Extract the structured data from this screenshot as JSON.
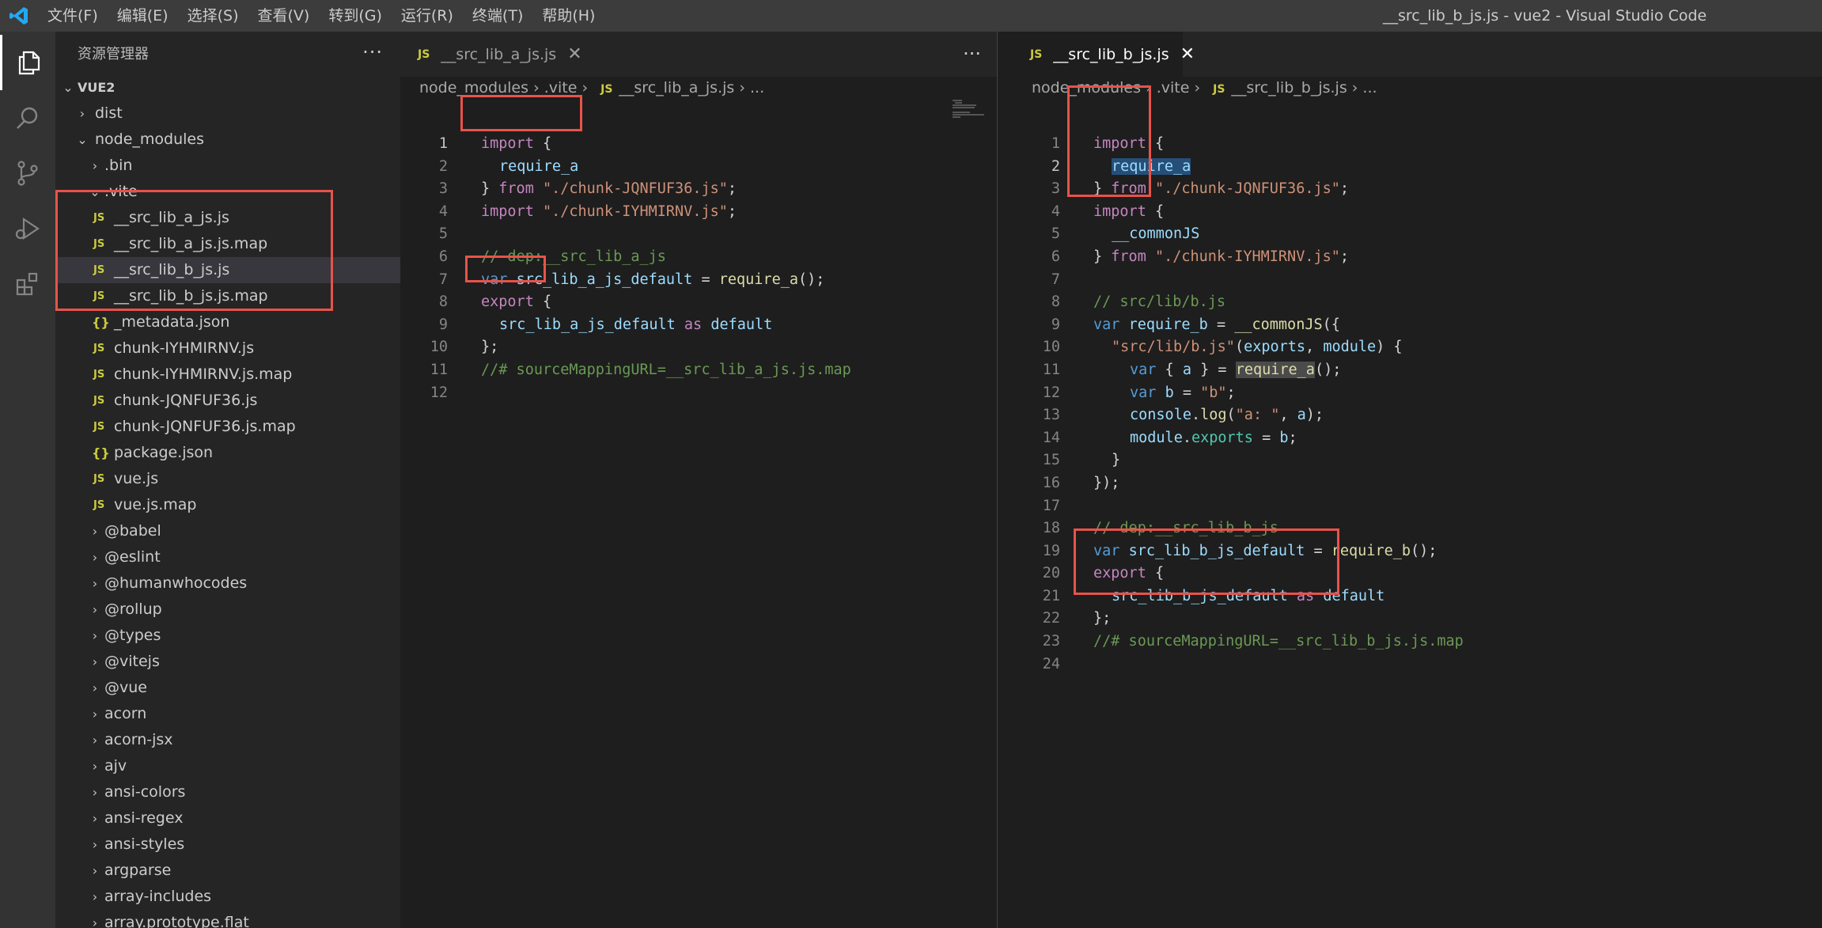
{
  "titlebar": {
    "menu": [
      "文件(F)",
      "编辑(E)",
      "选择(S)",
      "查看(V)",
      "转到(G)",
      "运行(R)",
      "终端(T)",
      "帮助(H)"
    ],
    "window_title": "__src_lib_b_js.js - vue2 - Visual Studio Code"
  },
  "activity": [
    "explorer-icon",
    "search-icon",
    "source-control-icon",
    "run-debug-icon",
    "extensions-icon"
  ],
  "sidebar": {
    "title": "资源管理器",
    "root": "VUE2",
    "items": {
      "dist": "dist",
      "node_modules": "node_modules",
      "bin": ".bin",
      "vite": ".vite",
      "a_js": "__src_lib_a_js.js",
      "a_map": "__src_lib_a_js.js.map",
      "b_js": "__src_lib_b_js.js",
      "b_map": "__src_lib_b_js.js.map",
      "metadata": "_metadata.json",
      "chunk_i": "chunk-IYHMIRNV.js",
      "chunk_i_map": "chunk-IYHMIRNV.js.map",
      "chunk_j": "chunk-JQNFUF36.js",
      "chunk_j_map": "chunk-JQNFUF36.js.map",
      "package": "package.json",
      "vue": "vue.js",
      "vue_map": "vue.js.map",
      "babel": "@babel",
      "eslint": "@eslint",
      "humanwhocodes": "@humanwhocodes",
      "rollup": "@rollup",
      "types": "@types",
      "vitejs": "@vitejs",
      "vue_pkg": "@vue",
      "acorn": "acorn",
      "acorn_jsx": "acorn-jsx",
      "ajv": "ajv",
      "ansi_colors": "ansi-colors",
      "ansi_regex": "ansi-regex",
      "ansi_styles": "ansi-styles",
      "argparse": "argparse",
      "array_includes": "array-includes",
      "array_flat": "array.prototype.flat"
    }
  },
  "editor_left": {
    "tab": "__src_lib_a_js.js",
    "breadcrumb": [
      "node_modules",
      ".vite",
      "__src_lib_a_js.js",
      "..."
    ],
    "lines": {
      "l1a": "import",
      "l1b": " {",
      "l2": "require_a",
      "l3a": "} ",
      "l3b": "from",
      "l3c": "\"./chunk-JQNFUF36.js\"",
      "l3d": ";",
      "l4a": "import",
      "l4b": "\"./chunk-IYHMIRNV.js\"",
      "l4c": ";",
      "l6": "// dep:__src_lib_a_js",
      "l7a": "var",
      "l7b": "src_lib_a_js_default",
      "l7c": " = ",
      "l7d": "require_a",
      "l7e": "();",
      "l8a": "export",
      "l8b": " {",
      "l9a": "src_lib_a_js_default",
      "l9b": "as",
      "l9c": "default",
      "l10": "};",
      "l11": "//# sourceMappingURL=__src_lib_a_js.js.map"
    }
  },
  "editor_right": {
    "tab": "__src_lib_b_js.js",
    "breadcrumb": [
      "node_modules",
      ".vite",
      "__src_lib_b_js.js",
      "..."
    ],
    "lines": {
      "l1a": "import",
      "l1b": " {",
      "l2": "require_a",
      "l3a": "} ",
      "l3b": "from",
      "l3c": "\"./chunk-JQNFUF36.js\"",
      "l3d": ";",
      "l4a": "import",
      "l4b": " {",
      "l5": "__commonJS",
      "l6a": "} ",
      "l6b": "from",
      "l6c": "\"./chunk-IYHMIRNV.js\"",
      "l6d": ";",
      "l8": "// src/lib/b.js",
      "l9a": "var",
      "l9b": "require_b",
      "l9c": " = ",
      "l9d": "__commonJS",
      "l9e": "({",
      "l10a": "\"src/lib/b.js\"",
      "l10b": "(",
      "l10c": "exports",
      "l10d": ", ",
      "l10e": "module",
      "l10f": ") {",
      "l11a": "var",
      "l11b": " { ",
      "l11c": "a",
      "l11d": " } = ",
      "l11e": "require_a",
      "l11f": "();",
      "l12a": "var",
      "l12b": "b",
      "l12c": " = ",
      "l12d": "\"b\"",
      "l12e": ";",
      "l13a": "console",
      "l13b": ".",
      "l13c": "log",
      "l13d": "(",
      "l13e": "\"a: \"",
      "l13f": ", ",
      "l13g": "a",
      "l13h": ");",
      "l14a": "module",
      "l14b": ".",
      "l14c": "exports",
      "l14d": " = ",
      "l14e": "b",
      "l14f": ";",
      "l15": "}",
      "l16": "});",
      "l18": "// dep:__src_lib_b_js",
      "l19a": "var",
      "l19b": "src_lib_b_js_default",
      "l19c": " = ",
      "l19d": "require_b",
      "l19e": "();",
      "l20a": "export",
      "l20b": " {",
      "l21a": "src_lib_b_js_default",
      "l21b": "as",
      "l21c": "default",
      "l22": "};",
      "l23": "//# sourceMappingURL=__src_lib_b_js.js.map"
    }
  },
  "line_numbers_left": [
    "1",
    "2",
    "3",
    "4",
    "5",
    "6",
    "7",
    "8",
    "9",
    "10",
    "11",
    "12"
  ],
  "line_numbers_right": [
    "1",
    "2",
    "3",
    "4",
    "5",
    "6",
    "7",
    "8",
    "9",
    "10",
    "11",
    "12",
    "13",
    "14",
    "15",
    "16",
    "17",
    "18",
    "19",
    "20",
    "21",
    "22",
    "23",
    "24"
  ],
  "colors": {
    "annotation": "#e8534a",
    "accent": "#007acc"
  }
}
